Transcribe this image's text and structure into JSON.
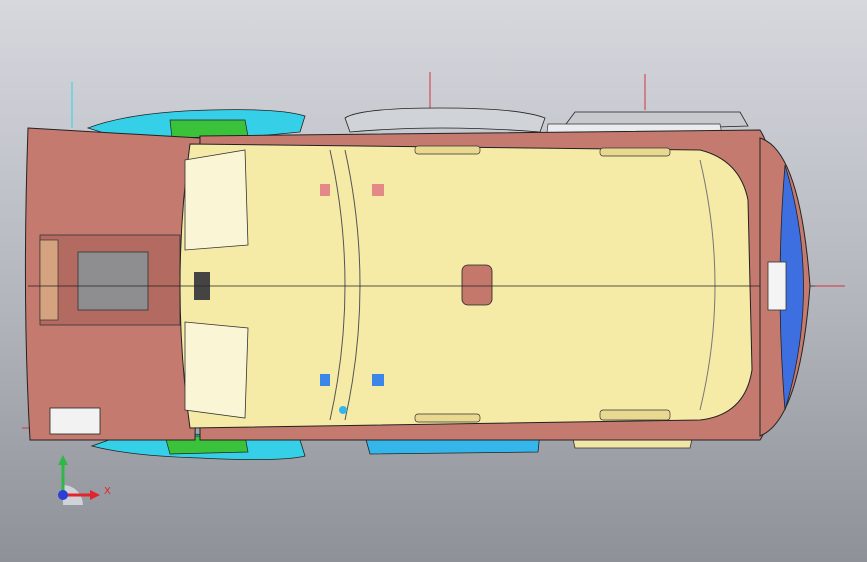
{
  "viewport": {
    "background_top": "#d6d8de",
    "background_bottom": "#8e9198"
  },
  "model": {
    "roof_color": "#f5eaa6",
    "body_color": "#c47a6e",
    "side_part_color": "#35d0e8",
    "bracket_color": "#3ac33a",
    "lamp_color": "#3d6fe0",
    "rack_color": "#c6c9ce",
    "centerline_color": "#d4343c"
  },
  "triad": {
    "x_label": "X",
    "x_color": "#e0262c",
    "y_color": "#2fb84a",
    "z_color": "#2b3fd6"
  }
}
